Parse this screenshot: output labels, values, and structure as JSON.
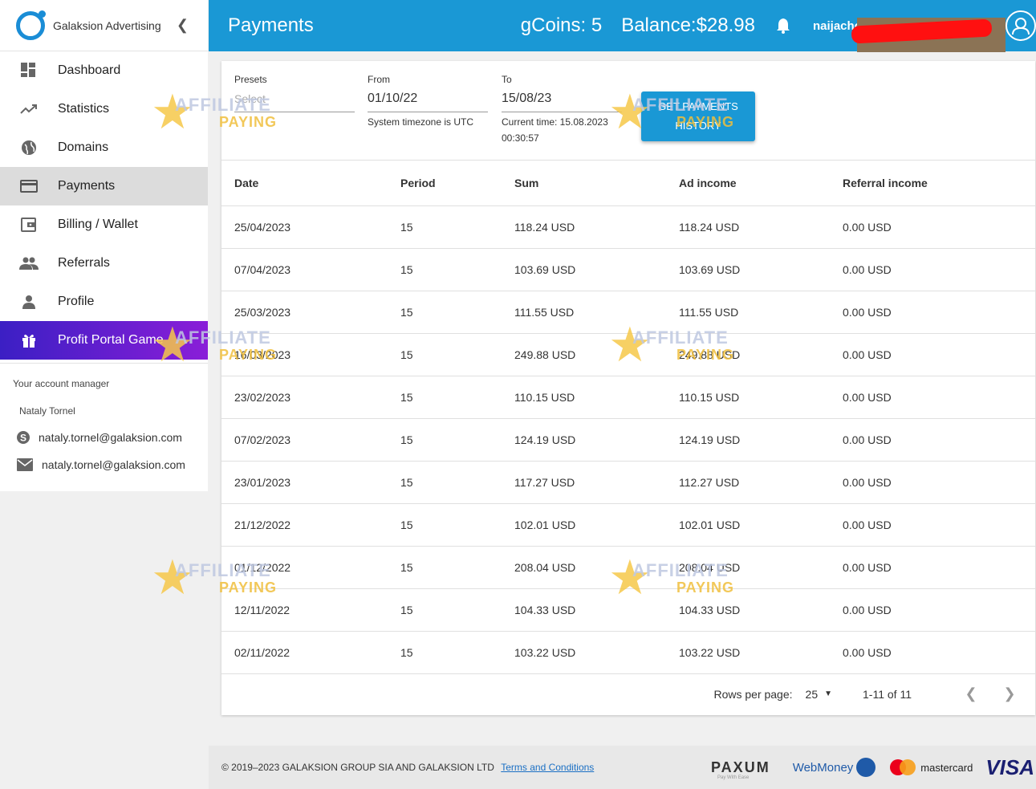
{
  "brand": {
    "name": "Galaksion Advertising",
    "collapse_icon": "chevron-left-icon"
  },
  "nav": [
    {
      "label": "Dashboard",
      "icon": "dashboard-icon"
    },
    {
      "label": "Statistics",
      "icon": "trending-up-icon"
    },
    {
      "label": "Domains",
      "icon": "globe-icon"
    },
    {
      "label": "Payments",
      "icon": "credit-card-icon",
      "active": true
    },
    {
      "label": "Billing / Wallet",
      "icon": "wallet-icon"
    },
    {
      "label": "Referrals",
      "icon": "people-icon"
    },
    {
      "label": "Profile",
      "icon": "person-icon"
    },
    {
      "label": "Profit Portal Game",
      "icon": "gift-icon"
    }
  ],
  "manager": {
    "title": "Your account manager",
    "name": "Nataly Tornel",
    "skype": "nataly.tornel@galaksion.com",
    "email": "nataly.tornel@galaksion.com"
  },
  "header": {
    "title": "Payments",
    "gcoins": "gCoins: 5",
    "balance": "Balance:$28.98",
    "username": "naijacho"
  },
  "filters": {
    "presets_label": "Presets",
    "presets_placeholder": "Select",
    "from_label": "From",
    "from_value": "01/10/22",
    "from_hint": "System timezone is UTC",
    "to_label": "To",
    "to_value": "15/08/23",
    "to_hint_1": "Current time: 15.08.2023",
    "to_hint_2": "00:30:57",
    "button_label": "GET PAYMENTS HISTORY"
  },
  "table": {
    "columns": [
      "Date",
      "Period",
      "Sum",
      "Ad income",
      "Referral income"
    ],
    "rows": [
      [
        "25/04/2023",
        "15",
        "118.24 USD",
        "118.24 USD",
        "0.00 USD"
      ],
      [
        "07/04/2023",
        "15",
        "103.69 USD",
        "103.69 USD",
        "0.00 USD"
      ],
      [
        "25/03/2023",
        "15",
        "111.55 USD",
        "111.55 USD",
        "0.00 USD"
      ],
      [
        "16/03/2023",
        "15",
        "249.88 USD",
        "249.88 USD",
        "0.00 USD"
      ],
      [
        "23/02/2023",
        "15",
        "110.15 USD",
        "110.15 USD",
        "0.00 USD"
      ],
      [
        "07/02/2023",
        "15",
        "124.19 USD",
        "124.19 USD",
        "0.00 USD"
      ],
      [
        "23/01/2023",
        "15",
        "117.27 USD",
        "112.27 USD",
        "0.00 USD"
      ],
      [
        "21/12/2022",
        "15",
        "102.01 USD",
        "102.01 USD",
        "0.00 USD"
      ],
      [
        "01/12/2022",
        "15",
        "208.04 USD",
        "208.04 USD",
        "0.00 USD"
      ],
      [
        "12/11/2022",
        "15",
        "104.33 USD",
        "104.33 USD",
        "0.00 USD"
      ],
      [
        "02/11/2022",
        "15",
        "103.22 USD",
        "103.22 USD",
        "0.00 USD"
      ]
    ]
  },
  "pager": {
    "rows_label": "Rows per page:",
    "rows_value": "25",
    "range": "1-11 of 11"
  },
  "footer": {
    "copyright": "© 2019–2023 GALAKSION GROUP SIA AND GALAKSION LTD",
    "terms": "Terms and Conditions",
    "logos": {
      "paxum": "PAXUM",
      "paxum_tag": "Pay With Ease",
      "webmoney": "WebMoney",
      "mastercard": "mastercard",
      "visa": "VISA"
    }
  },
  "watermark": {
    "line1": "AFFILIATE",
    "line2": "PAYING"
  },
  "colors": {
    "header": "#1a98d5",
    "active_nav": "#dcdcdc",
    "promo_start": "#3b1fc4",
    "promo_end": "#8a1ed8"
  }
}
